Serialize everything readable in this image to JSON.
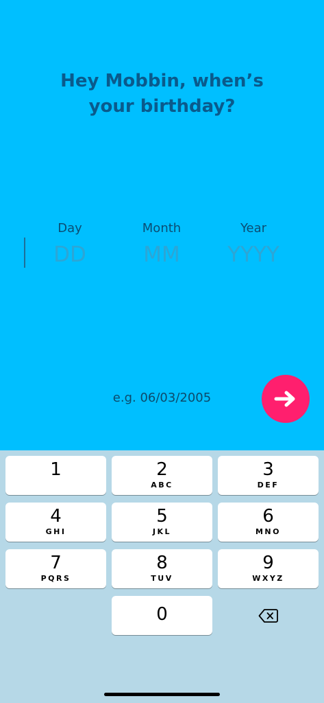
{
  "prompt": {
    "line1": "Hey Mobbin,  when’s",
    "line2": "your birthday?"
  },
  "fields": {
    "day": {
      "label": "Day",
      "placeholder": "DD",
      "value": ""
    },
    "month": {
      "label": "Month",
      "placeholder": "MM",
      "value": ""
    },
    "year": {
      "label": "Year",
      "placeholder": "YYYY",
      "value": ""
    }
  },
  "example_text": "e.g. 06/03/2005",
  "next_button": {
    "icon": "arrow-right-icon",
    "color": "#FF1F6E"
  },
  "colors": {
    "background": "#00BFFF",
    "heading": "#0A5A8C",
    "keyboard": "#B6D8E7"
  },
  "keypad": {
    "keys": [
      {
        "digit": "1",
        "letters": ""
      },
      {
        "digit": "2",
        "letters": "ABC"
      },
      {
        "digit": "3",
        "letters": "DEF"
      },
      {
        "digit": "4",
        "letters": "GHI"
      },
      {
        "digit": "5",
        "letters": "JKL"
      },
      {
        "digit": "6",
        "letters": "MNO"
      },
      {
        "digit": "7",
        "letters": "PQRS"
      },
      {
        "digit": "8",
        "letters": "TUV"
      },
      {
        "digit": "9",
        "letters": "WXYZ"
      },
      {
        "digit": "0",
        "letters": ""
      }
    ],
    "delete_icon": "backspace-icon"
  }
}
